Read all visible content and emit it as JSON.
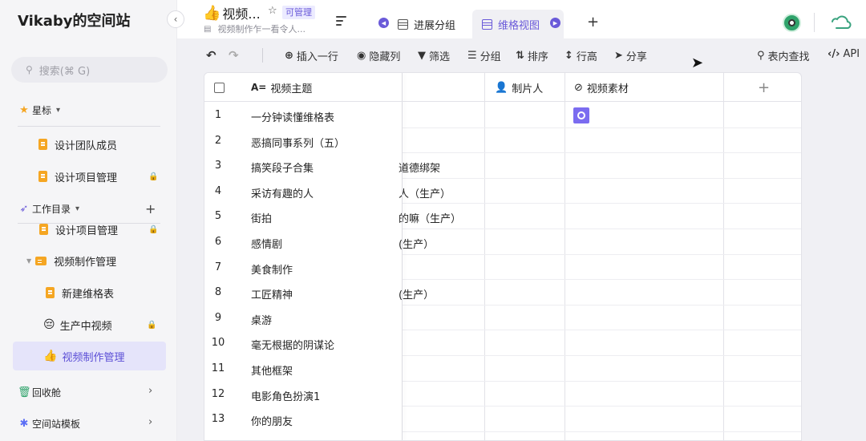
{
  "sidebar": {
    "space_title": "Vikaby的空间站",
    "collapse_glyph": "‹",
    "search_placeholder": "搜索(⌘ G)",
    "starred_label": "星标",
    "starred_items": [
      {
        "label": "设计团队成员",
        "locked": false
      },
      {
        "label": "设计项目管理",
        "locked": true
      }
    ],
    "workdir_label": "工作目录",
    "workdir_items": [
      {
        "label": "设计项目管理",
        "locked": true
      },
      {
        "label": "视频制作管理",
        "locked": false
      },
      {
        "label": "新建维格表",
        "locked": false
      },
      {
        "label": "生产中视频",
        "locked": true
      },
      {
        "label": "视频制作管理",
        "locked": false
      }
    ],
    "trash_label": "回收舱",
    "templates_label": "空间站模板"
  },
  "header": {
    "view_title": "视频...",
    "view_emoji": "👍",
    "permission_badge": "可管理",
    "description": "视频制作乍一看令人...",
    "tabs": [
      {
        "label": "进展分组",
        "active": false
      },
      {
        "label": "维格视图",
        "active": true
      }
    ]
  },
  "toolbar": {
    "insert_row": "插入一行",
    "hide_columns": "隐藏列",
    "filter": "筛选",
    "group": "分组",
    "sort": "排序",
    "row_height": "行高",
    "share": "分享",
    "search_in_table": "表内查找",
    "api": "API"
  },
  "grid": {
    "columns": {
      "title": "视频主题",
      "producer": "制片人",
      "assets": "视频素材"
    },
    "rows": [
      {
        "num": "1",
        "title": "一分钟读懂维格表",
        "hidden": ""
      },
      {
        "num": "2",
        "title": "恶搞同事系列（五）",
        "hidden": ""
      },
      {
        "num": "3",
        "title": "搞笑段子合集",
        "hidden": "道德绑架"
      },
      {
        "num": "4",
        "title": "采访有趣的人",
        "hidden": "人（生产）"
      },
      {
        "num": "5",
        "title": "街拍",
        "hidden": "的嘛（生产）"
      },
      {
        "num": "6",
        "title": "感情剧",
        "hidden": "(生产）"
      },
      {
        "num": "7",
        "title": "美食制作",
        "hidden": ""
      },
      {
        "num": "8",
        "title": "工匠精神",
        "hidden": "(生产）"
      },
      {
        "num": "9",
        "title": "桌游",
        "hidden": ""
      },
      {
        "num": "10",
        "title": "毫无根据的阴谋论",
        "hidden": ""
      },
      {
        "num": "11",
        "title": "其他框架",
        "hidden": ""
      },
      {
        "num": "12",
        "title": "电影角色扮演1",
        "hidden": ""
      },
      {
        "num": "13",
        "title": "你的朋友",
        "hidden": ""
      }
    ]
  },
  "colors": {
    "accent": "#6a5ad9",
    "active_nav_bg": "#e5e4fa",
    "doc_icon": "#f5a623"
  }
}
